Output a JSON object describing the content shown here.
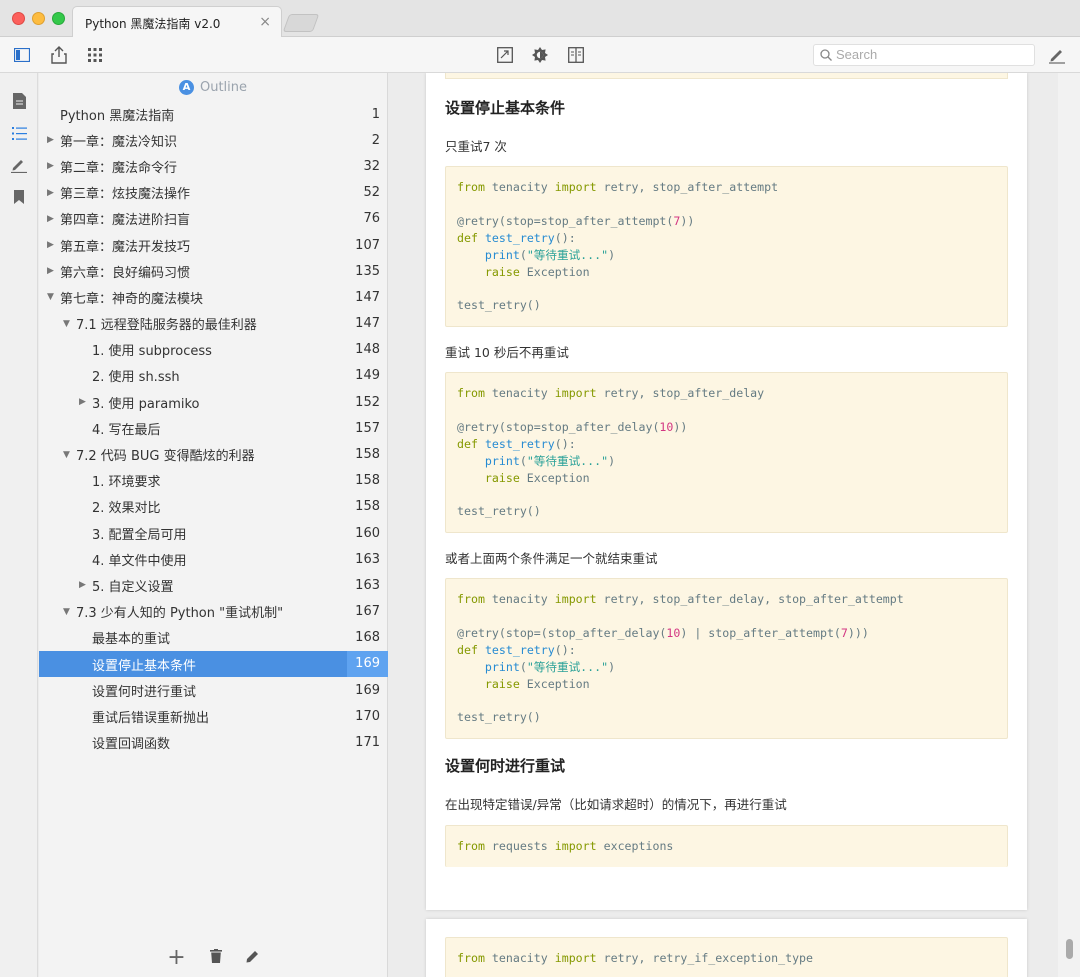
{
  "window": {
    "tab_title": "Python 黑魔法指南 v2.0",
    "tab_close": "×"
  },
  "toolbar": {
    "search_placeholder": "Search"
  },
  "outline": {
    "header": "Outline",
    "badge": "A",
    "items": [
      {
        "label": "Python 黑魔法指南",
        "page": "1",
        "level": 0,
        "arrow": ""
      },
      {
        "label": "第一章：魔法冷知识",
        "page": "2",
        "level": 0,
        "arrow": "▶"
      },
      {
        "label": "第二章：魔法命令行",
        "page": "32",
        "level": 0,
        "arrow": "▶"
      },
      {
        "label": "第三章：炫技魔法操作",
        "page": "52",
        "level": 0,
        "arrow": "▶"
      },
      {
        "label": "第四章：魔法进阶扫盲",
        "page": "76",
        "level": 0,
        "arrow": "▶"
      },
      {
        "label": "第五章：魔法开发技巧",
        "page": "107",
        "level": 0,
        "arrow": "▶"
      },
      {
        "label": "第六章：良好编码习惯",
        "page": "135",
        "level": 0,
        "arrow": "▶"
      },
      {
        "label": "第七章：神奇的魔法模块",
        "page": "147",
        "level": 0,
        "arrow": "▼"
      },
      {
        "label": "7.1 远程登陆服务器的最佳利器",
        "page": "147",
        "level": 1,
        "arrow": "▼"
      },
      {
        "label": "1. 使用 subprocess",
        "page": "148",
        "level": 2,
        "arrow": ""
      },
      {
        "label": "2. 使用 sh.ssh",
        "page": "149",
        "level": 2,
        "arrow": ""
      },
      {
        "label": "3. 使用 paramiko",
        "page": "152",
        "level": 2,
        "arrow": "▶"
      },
      {
        "label": "4. 写在最后",
        "page": "157",
        "level": 2,
        "arrow": ""
      },
      {
        "label": "7.2 代码 BUG 变得酷炫的利器",
        "page": "158",
        "level": 1,
        "arrow": "▼"
      },
      {
        "label": "1. 环境要求",
        "page": "158",
        "level": 2,
        "arrow": ""
      },
      {
        "label": "2. 效果对比",
        "page": "158",
        "level": 2,
        "arrow": ""
      },
      {
        "label": "3. 配置全局可用",
        "page": "160",
        "level": 2,
        "arrow": ""
      },
      {
        "label": "4. 单文件中使用",
        "page": "163",
        "level": 2,
        "arrow": ""
      },
      {
        "label": "5. 自定义设置",
        "page": "163",
        "level": 2,
        "arrow": "▶"
      },
      {
        "label": "7.3 少有人知的 Python \"重试机制\"",
        "page": "167",
        "level": 1,
        "arrow": "▼"
      },
      {
        "label": "最基本的重试",
        "page": "168",
        "level": 2,
        "arrow": ""
      },
      {
        "label": "设置停止基本条件",
        "page": "169",
        "level": 2,
        "arrow": "",
        "active": true
      },
      {
        "label": "设置何时进行重试",
        "page": "169",
        "level": 2,
        "arrow": ""
      },
      {
        "label": "重试后错误重新抛出",
        "page": "170",
        "level": 2,
        "arrow": ""
      },
      {
        "label": "设置回调函数",
        "page": "171",
        "level": 2,
        "arrow": ""
      }
    ],
    "footer": {
      "add": "+",
      "delete": "🗑",
      "edit": "✎"
    }
  },
  "doc": {
    "h_stop": "设置停止基本条件",
    "p_attempt": "只重试7 次",
    "p_delay": "重试 10 秒后不再重试",
    "p_either": "或者上面两个条件满足一个就结束重试",
    "h_when": "设置何时进行重试",
    "p_when": "在出现特定错误/异常（比如请求超时）的情况下，再进行重试"
  }
}
